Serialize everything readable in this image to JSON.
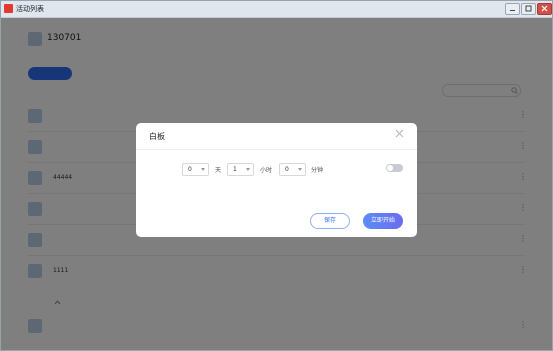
{
  "window": {
    "title": "活动列表"
  },
  "header": {
    "id": "130701",
    "id_sub": "",
    "tab": "",
    "right_label": ""
  },
  "toolbar": {
    "new_button": "",
    "search_placeholder": ""
  },
  "filters": [
    {
      "label": ""
    },
    {
      "label": ""
    },
    {
      "label": ""
    },
    {
      "label": ""
    },
    {
      "label": ""
    }
  ],
  "rows": [
    {
      "name": "",
      "action": ""
    },
    {
      "name": "",
      "action": ""
    },
    {
      "name": "44444",
      "action": ""
    },
    {
      "name": "",
      "action": ""
    },
    {
      "name": "",
      "action": ""
    },
    {
      "name": "1111",
      "action": ""
    }
  ],
  "section": {
    "label": ""
  },
  "section_rows": [
    {
      "name": "",
      "action": ""
    }
  ],
  "dialog": {
    "title": "白板",
    "duration_label": "",
    "days_value": "0",
    "days_unit": "天",
    "hours_value": "1",
    "hours_unit": "小时",
    "minutes_value": "0",
    "minutes_unit": "分钟",
    "manual_end_label": "",
    "manual_end_on": false,
    "save_label": "保存",
    "start_label": "立即开始"
  },
  "colors": {
    "primary": "#2f6cf4",
    "overlay": "rgba(0,0,0,0.5)",
    "close_red": "#d0504a"
  }
}
